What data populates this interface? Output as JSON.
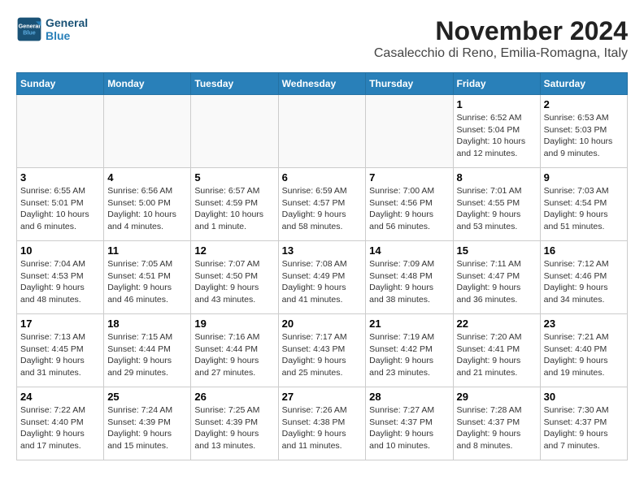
{
  "header": {
    "logo_line1": "General",
    "logo_line2": "Blue",
    "month": "November 2024",
    "location": "Casalecchio di Reno, Emilia-Romagna, Italy"
  },
  "weekdays": [
    "Sunday",
    "Monday",
    "Tuesday",
    "Wednesday",
    "Thursday",
    "Friday",
    "Saturday"
  ],
  "weeks": [
    [
      {
        "day": "",
        "info": ""
      },
      {
        "day": "",
        "info": ""
      },
      {
        "day": "",
        "info": ""
      },
      {
        "day": "",
        "info": ""
      },
      {
        "day": "",
        "info": ""
      },
      {
        "day": "1",
        "info": "Sunrise: 6:52 AM\nSunset: 5:04 PM\nDaylight: 10 hours and 12 minutes."
      },
      {
        "day": "2",
        "info": "Sunrise: 6:53 AM\nSunset: 5:03 PM\nDaylight: 10 hours and 9 minutes."
      }
    ],
    [
      {
        "day": "3",
        "info": "Sunrise: 6:55 AM\nSunset: 5:01 PM\nDaylight: 10 hours and 6 minutes."
      },
      {
        "day": "4",
        "info": "Sunrise: 6:56 AM\nSunset: 5:00 PM\nDaylight: 10 hours and 4 minutes."
      },
      {
        "day": "5",
        "info": "Sunrise: 6:57 AM\nSunset: 4:59 PM\nDaylight: 10 hours and 1 minute."
      },
      {
        "day": "6",
        "info": "Sunrise: 6:59 AM\nSunset: 4:57 PM\nDaylight: 9 hours and 58 minutes."
      },
      {
        "day": "7",
        "info": "Sunrise: 7:00 AM\nSunset: 4:56 PM\nDaylight: 9 hours and 56 minutes."
      },
      {
        "day": "8",
        "info": "Sunrise: 7:01 AM\nSunset: 4:55 PM\nDaylight: 9 hours and 53 minutes."
      },
      {
        "day": "9",
        "info": "Sunrise: 7:03 AM\nSunset: 4:54 PM\nDaylight: 9 hours and 51 minutes."
      }
    ],
    [
      {
        "day": "10",
        "info": "Sunrise: 7:04 AM\nSunset: 4:53 PM\nDaylight: 9 hours and 48 minutes."
      },
      {
        "day": "11",
        "info": "Sunrise: 7:05 AM\nSunset: 4:51 PM\nDaylight: 9 hours and 46 minutes."
      },
      {
        "day": "12",
        "info": "Sunrise: 7:07 AM\nSunset: 4:50 PM\nDaylight: 9 hours and 43 minutes."
      },
      {
        "day": "13",
        "info": "Sunrise: 7:08 AM\nSunset: 4:49 PM\nDaylight: 9 hours and 41 minutes."
      },
      {
        "day": "14",
        "info": "Sunrise: 7:09 AM\nSunset: 4:48 PM\nDaylight: 9 hours and 38 minutes."
      },
      {
        "day": "15",
        "info": "Sunrise: 7:11 AM\nSunset: 4:47 PM\nDaylight: 9 hours and 36 minutes."
      },
      {
        "day": "16",
        "info": "Sunrise: 7:12 AM\nSunset: 4:46 PM\nDaylight: 9 hours and 34 minutes."
      }
    ],
    [
      {
        "day": "17",
        "info": "Sunrise: 7:13 AM\nSunset: 4:45 PM\nDaylight: 9 hours and 31 minutes."
      },
      {
        "day": "18",
        "info": "Sunrise: 7:15 AM\nSunset: 4:44 PM\nDaylight: 9 hours and 29 minutes."
      },
      {
        "day": "19",
        "info": "Sunrise: 7:16 AM\nSunset: 4:44 PM\nDaylight: 9 hours and 27 minutes."
      },
      {
        "day": "20",
        "info": "Sunrise: 7:17 AM\nSunset: 4:43 PM\nDaylight: 9 hours and 25 minutes."
      },
      {
        "day": "21",
        "info": "Sunrise: 7:19 AM\nSunset: 4:42 PM\nDaylight: 9 hours and 23 minutes."
      },
      {
        "day": "22",
        "info": "Sunrise: 7:20 AM\nSunset: 4:41 PM\nDaylight: 9 hours and 21 minutes."
      },
      {
        "day": "23",
        "info": "Sunrise: 7:21 AM\nSunset: 4:40 PM\nDaylight: 9 hours and 19 minutes."
      }
    ],
    [
      {
        "day": "24",
        "info": "Sunrise: 7:22 AM\nSunset: 4:40 PM\nDaylight: 9 hours and 17 minutes."
      },
      {
        "day": "25",
        "info": "Sunrise: 7:24 AM\nSunset: 4:39 PM\nDaylight: 9 hours and 15 minutes."
      },
      {
        "day": "26",
        "info": "Sunrise: 7:25 AM\nSunset: 4:39 PM\nDaylight: 9 hours and 13 minutes."
      },
      {
        "day": "27",
        "info": "Sunrise: 7:26 AM\nSunset: 4:38 PM\nDaylight: 9 hours and 11 minutes."
      },
      {
        "day": "28",
        "info": "Sunrise: 7:27 AM\nSunset: 4:37 PM\nDaylight: 9 hours and 10 minutes."
      },
      {
        "day": "29",
        "info": "Sunrise: 7:28 AM\nSunset: 4:37 PM\nDaylight: 9 hours and 8 minutes."
      },
      {
        "day": "30",
        "info": "Sunrise: 7:30 AM\nSunset: 4:37 PM\nDaylight: 9 hours and 7 minutes."
      }
    ]
  ]
}
